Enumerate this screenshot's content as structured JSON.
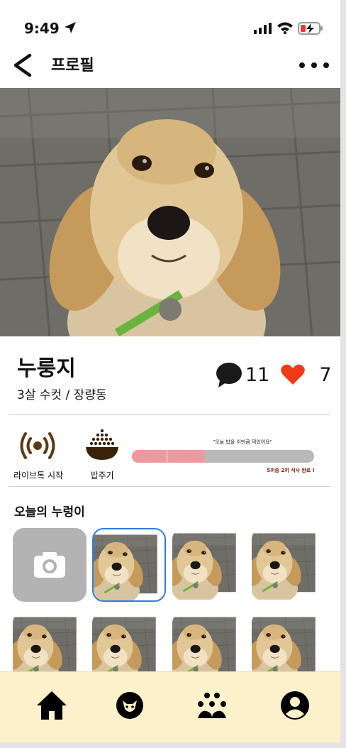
{
  "status_bar": {
    "time": "9:49"
  },
  "nav": {
    "title": "프로필"
  },
  "profile": {
    "name": "누룽지",
    "meta": "3살 수컷  / 장량동",
    "comment_count": "11",
    "like_count": "7"
  },
  "actions": {
    "live_label": "라이브톡 시작",
    "feed_label": "밥주기",
    "feed_quote": "\"오늘 밥을 이만큼 먹었어요\"",
    "feed_note": "5끼중 2끼 식사 완료 !",
    "feed_progress": 0.4
  },
  "gallery": {
    "title": "오늘의 누렁이"
  },
  "icons": {
    "back": "back-arrow-icon",
    "more": "more-dots-icon",
    "comment": "speech-bubble-icon",
    "heart": "heart-icon",
    "live": "broadcast-icon",
    "feed": "food-bowl-icon",
    "camera": "camera-icon",
    "tabs": [
      "home-icon",
      "cat-face-icon",
      "paw-icon",
      "user-icon"
    ]
  },
  "colors": {
    "heart": "#ee3b16",
    "progress_fill": "#ec9aa0",
    "progress_track": "#b9b9b9",
    "tabbar_bg": "#fcf1cb",
    "selected_border": "#2f7de1",
    "live_icon": "#5a3a14"
  }
}
